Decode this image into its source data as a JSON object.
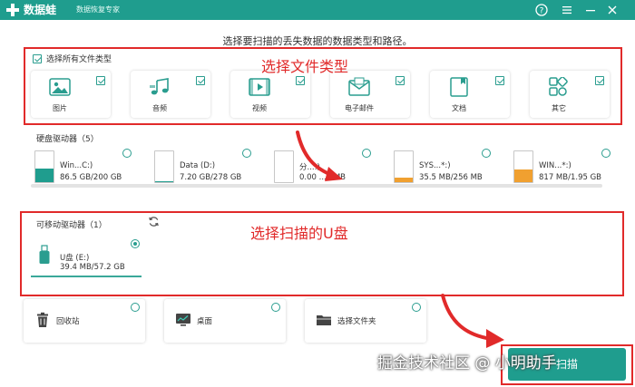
{
  "app": {
    "name": "数据蛙",
    "subtitle": "数据恢复专家"
  },
  "headline": "选择要扫描的丢失数据的数据类型和路径。",
  "file_types": {
    "select_all_label": "选择所有文件类型",
    "select_all_checked": true,
    "items": [
      {
        "label": "图片",
        "icon": "image-icon",
        "checked": true
      },
      {
        "label": "音频",
        "icon": "music-icon",
        "checked": true
      },
      {
        "label": "视频",
        "icon": "video-icon",
        "checked": true
      },
      {
        "label": "电子邮件",
        "icon": "email-icon",
        "checked": true
      },
      {
        "label": "文档",
        "icon": "document-icon",
        "checked": true
      },
      {
        "label": "其它",
        "icon": "other-files-icon",
        "checked": true
      }
    ]
  },
  "hard_drives": {
    "label": "硬盘驱动器（5）",
    "items": [
      {
        "name": "Win...C:)",
        "size": "86.5 GB/200 GB",
        "used_fraction": 0.43,
        "fill_color": "#1f9d8e"
      },
      {
        "name": "Data (D:)",
        "size": "7.20 GB/278 GB",
        "used_fraction": 0.03,
        "fill_color": "#1f9d8e"
      },
      {
        "name": "分...:)",
        "size": "0.00 ...0 MB",
        "used_fraction": 0.0,
        "fill_color": "#f0a030"
      },
      {
        "name": "SYS...*:)",
        "size": "35.5 MB/256 MB",
        "used_fraction": 0.14,
        "fill_color": "#f0a030"
      },
      {
        "name": "WIN...*:)",
        "size": "817 MB/1.95 GB",
        "used_fraction": 0.41,
        "fill_color": "#f0a030"
      }
    ]
  },
  "removable_drives": {
    "label": "可移动驱动器（1）",
    "items": [
      {
        "name": "U盘 (E:)",
        "size": "39.4 MB/57.2 GB",
        "selected": true
      }
    ]
  },
  "locations": [
    {
      "label": "回收站",
      "icon": "recycle-bin-icon"
    },
    {
      "label": "桌面",
      "icon": "desktop-icon"
    },
    {
      "label": "选择文件夹",
      "icon": "folder-icon"
    }
  ],
  "scan_button": "扫描",
  "annotations": {
    "file_type_note": "选择文件类型",
    "usb_note": "选择扫描的U盘",
    "color": "#e12a2a"
  },
  "watermark": "掘金技术社区 @ 小明助手",
  "colors": {
    "brand": "#1f9d8e",
    "warning": "#f0a030"
  }
}
